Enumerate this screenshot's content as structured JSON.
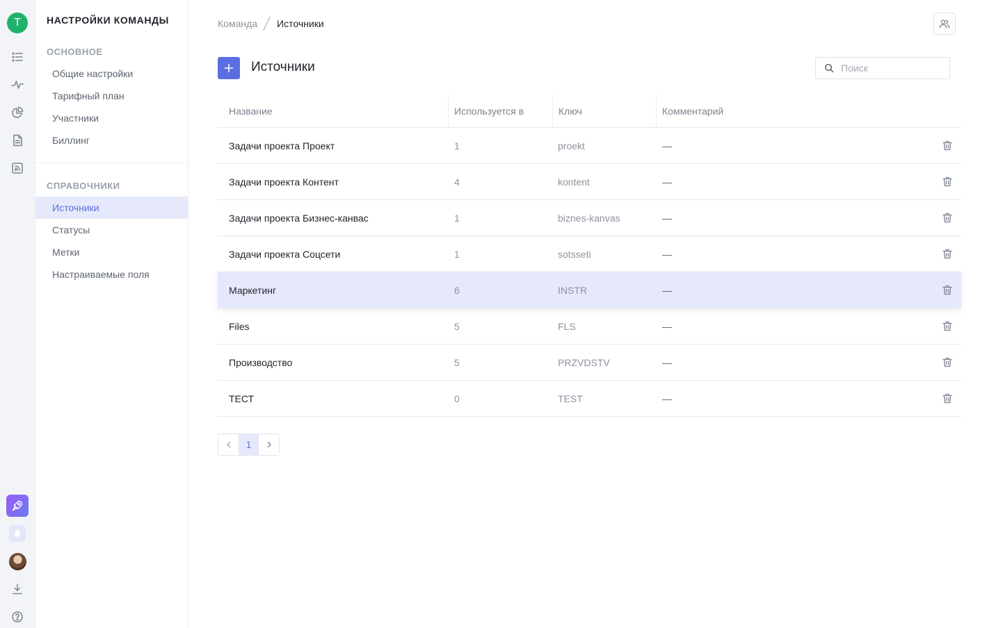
{
  "rail": {
    "team_initial": "T",
    "accent": "#20b26b",
    "icons": [
      "list-icon",
      "activity-icon",
      "pie-chart-icon",
      "document-icon",
      "rss-icon",
      "rocket-icon",
      "bell-icon",
      "download-icon",
      "help-icon"
    ]
  },
  "sidebar": {
    "title": "НАСТРОЙКИ КОМАНДЫ",
    "section_main": "ОСНОВНОЕ",
    "main_items": [
      {
        "label": "Общие настройки"
      },
      {
        "label": "Тарифный план"
      },
      {
        "label": "Участники"
      },
      {
        "label": "Биллинг"
      }
    ],
    "section_refs": "СПРАВОЧНИКИ",
    "ref_items": [
      {
        "label": "Источники",
        "active": true
      },
      {
        "label": "Статусы"
      },
      {
        "label": "Метки"
      },
      {
        "label": "Настраиваемые поля"
      }
    ]
  },
  "breadcrumb": {
    "team": "Команда",
    "current": "Источники"
  },
  "header": {
    "title": "Источники",
    "add_label": "+",
    "search_placeholder": "Поиск"
  },
  "table": {
    "columns": [
      "Название",
      "Используется в",
      "Ключ",
      "Комментарий"
    ],
    "rows": [
      {
        "name": "Задачи проекта Проект",
        "used": "1",
        "key": "proekt",
        "comment": "—"
      },
      {
        "name": "Задачи проекта Контент",
        "used": "4",
        "key": "kontent",
        "comment": "—"
      },
      {
        "name": "Задачи проекта Бизнес-канвас",
        "used": "1",
        "key": "biznes-kanvas",
        "comment": "—"
      },
      {
        "name": "Задачи проекта Соцсети",
        "used": "1",
        "key": "sotsseti",
        "comment": "—"
      },
      {
        "name": "Маркетинг",
        "used": "6",
        "key": "INSTR",
        "comment": "—",
        "highlighted": true
      },
      {
        "name": "Files",
        "used": "5",
        "key": "FLS",
        "comment": "—"
      },
      {
        "name": "Производство",
        "used": "5",
        "key": "PRZVDSTV",
        "comment": "—"
      },
      {
        "name": "ТЕСТ",
        "used": "0",
        "key": "TEST",
        "comment": "—"
      }
    ]
  },
  "pagination": {
    "current": "1",
    "prev_icon": "chevron-left-icon",
    "next_icon": "chevron-right-icon"
  },
  "colors": {
    "primary": "#5b6ee1",
    "active_bg": "#e6e9fb",
    "team_avatar": "#20b26b"
  }
}
